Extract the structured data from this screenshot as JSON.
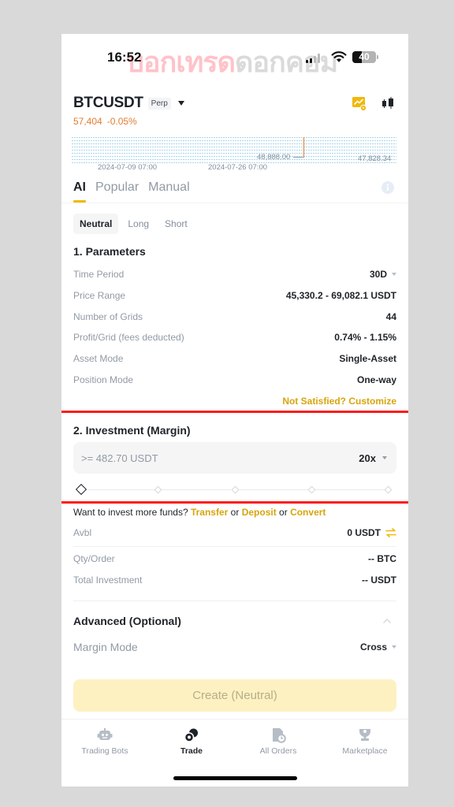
{
  "status_bar": {
    "time": "16:52",
    "watermark_part1": "บอกเทรด",
    "watermark_part2": "ดอกคอม",
    "battery_percent": "40",
    "battery_level": 0.4
  },
  "header": {
    "pair": "BTCUSDT",
    "contract_tag": "Perp",
    "last_price": "57,404",
    "change": "-0.05%",
    "icons": [
      "chart-settings-icon",
      "candlestick-icon"
    ]
  },
  "mini_chart": {
    "price_mid_label": "48,888.00",
    "price_right_label": "47,828.34",
    "date_labels": [
      "2024-07-09 07:00",
      "2024-07-26 07:00"
    ]
  },
  "tabs": [
    {
      "label": "AI",
      "active": true
    },
    {
      "label": "Popular",
      "active": false
    },
    {
      "label": "Manual",
      "active": false
    }
  ],
  "directions": [
    {
      "label": "Neutral",
      "active": true
    },
    {
      "label": "Long",
      "active": false
    },
    {
      "label": "Short",
      "active": false
    }
  ],
  "parameters": {
    "title": "1. Parameters",
    "rows": [
      {
        "label": "Time Period",
        "value": "30D",
        "dropdown": true
      },
      {
        "label": "Price Range",
        "value": "45,330.2 - 69,082.1 USDT"
      },
      {
        "label": "Number of Grids",
        "value": "44"
      },
      {
        "label": "Profit/Grid (fees deducted)",
        "value": "0.74% - 1.15%"
      },
      {
        "label": "Asset Mode",
        "value": "Single-Asset"
      },
      {
        "label": "Position Mode",
        "value": "One-way"
      }
    ],
    "customize_link": "Not Satisfied? Customize"
  },
  "investment": {
    "title": "2. Investment (Margin)",
    "input_value": "",
    "input_placeholder": ">= 482.70 USDT",
    "leverage": "20x",
    "slider_percent": 0,
    "funds_prompt": "Want to invest more funds?",
    "links": [
      "Transfer",
      "Deposit",
      "Convert"
    ],
    "or_text": "or",
    "avbl_label": "Avbl",
    "avbl_value": "0 USDT",
    "qty_label": "Qty/Order",
    "qty_value": "-- BTC",
    "total_label": "Total Investment",
    "total_value": "-- USDT"
  },
  "advanced": {
    "title": "Advanced (Optional)",
    "margin_mode_label": "Margin Mode",
    "margin_mode_value": "Cross"
  },
  "create_button": "Create (Neutral)",
  "bottom_nav": [
    {
      "label": "Trading Bots",
      "icon": "robot-icon",
      "active": false
    },
    {
      "label": "Trade",
      "icon": "trade-icon",
      "active": true
    },
    {
      "label": "All Orders",
      "icon": "orders-icon",
      "active": false
    },
    {
      "label": "Marketplace",
      "icon": "trophy-icon",
      "active": false
    }
  ],
  "colors": {
    "accent": "#f0b90b",
    "link": "#d8a40c",
    "price_negative": "#e27d35",
    "highlight_box": "#ff1a1a"
  }
}
